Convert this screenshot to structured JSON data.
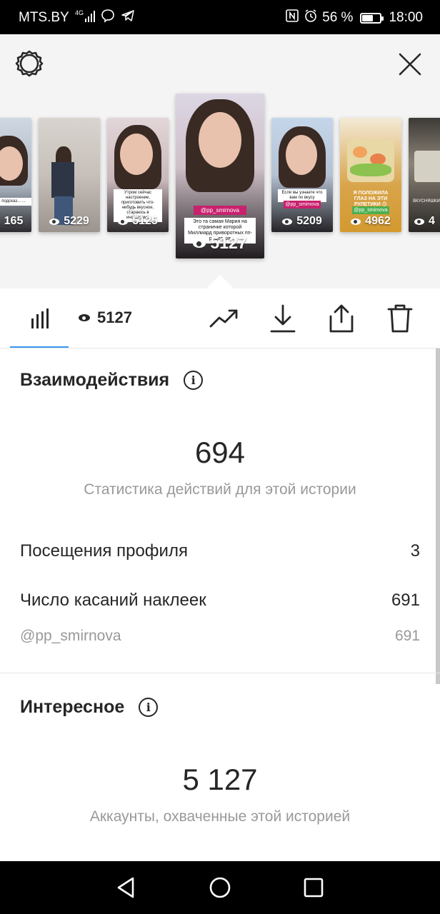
{
  "status_bar": {
    "carrier": "MTS.BY",
    "signal": "⁴ᴳ",
    "battery_percent": "56 %",
    "battery_level": 0.56,
    "time": "18:00"
  },
  "thumbnails": [
    {
      "views": "165",
      "caption": "подсказ... ..."
    },
    {
      "views": "5229"
    },
    {
      "views": "5125",
      "caption": "Утром сейчас настроение, приготовить что-нибудь вкусное, стараюсь в инстаграме"
    },
    {
      "views": "5127",
      "tag": "@pp_smirnova",
      "caption": "Это та самая Мария на страничке которой Миллиард приворотных пп-рецептов",
      "selected": true
    },
    {
      "views": "5209",
      "tag": "@pp_smirnova",
      "caption": "Если вы узнаете что вам по вкусу"
    },
    {
      "views": "4962",
      "tag": "@pp_smirnova",
      "caption": "Я ПОЛОЖИЛА ГЛАЗ НА ЭТИ РУЛЕТИКИ 😍"
    },
    {
      "views": "4",
      "caption": "ВКУСНЯШКИ"
    }
  ],
  "tabs": {
    "stats_icon": "bar-chart-icon",
    "views_count": "5127"
  },
  "interactions": {
    "title": "Взаимодействия",
    "total": "694",
    "subtitle": "Статистика действий для этой истории",
    "rows": [
      {
        "label": "Посещения профиля",
        "value": "3"
      },
      {
        "label": "Число касаний наклеек",
        "value": "691"
      }
    ],
    "sub_row": {
      "label": "@pp_smirnova",
      "value": "691"
    }
  },
  "discovery": {
    "title": "Интересное",
    "total": "5 127",
    "subtitle": "Аккаунты, охваченные этой историей"
  },
  "colors": {
    "accent": "#3897f0",
    "tag": "#c8216e"
  }
}
